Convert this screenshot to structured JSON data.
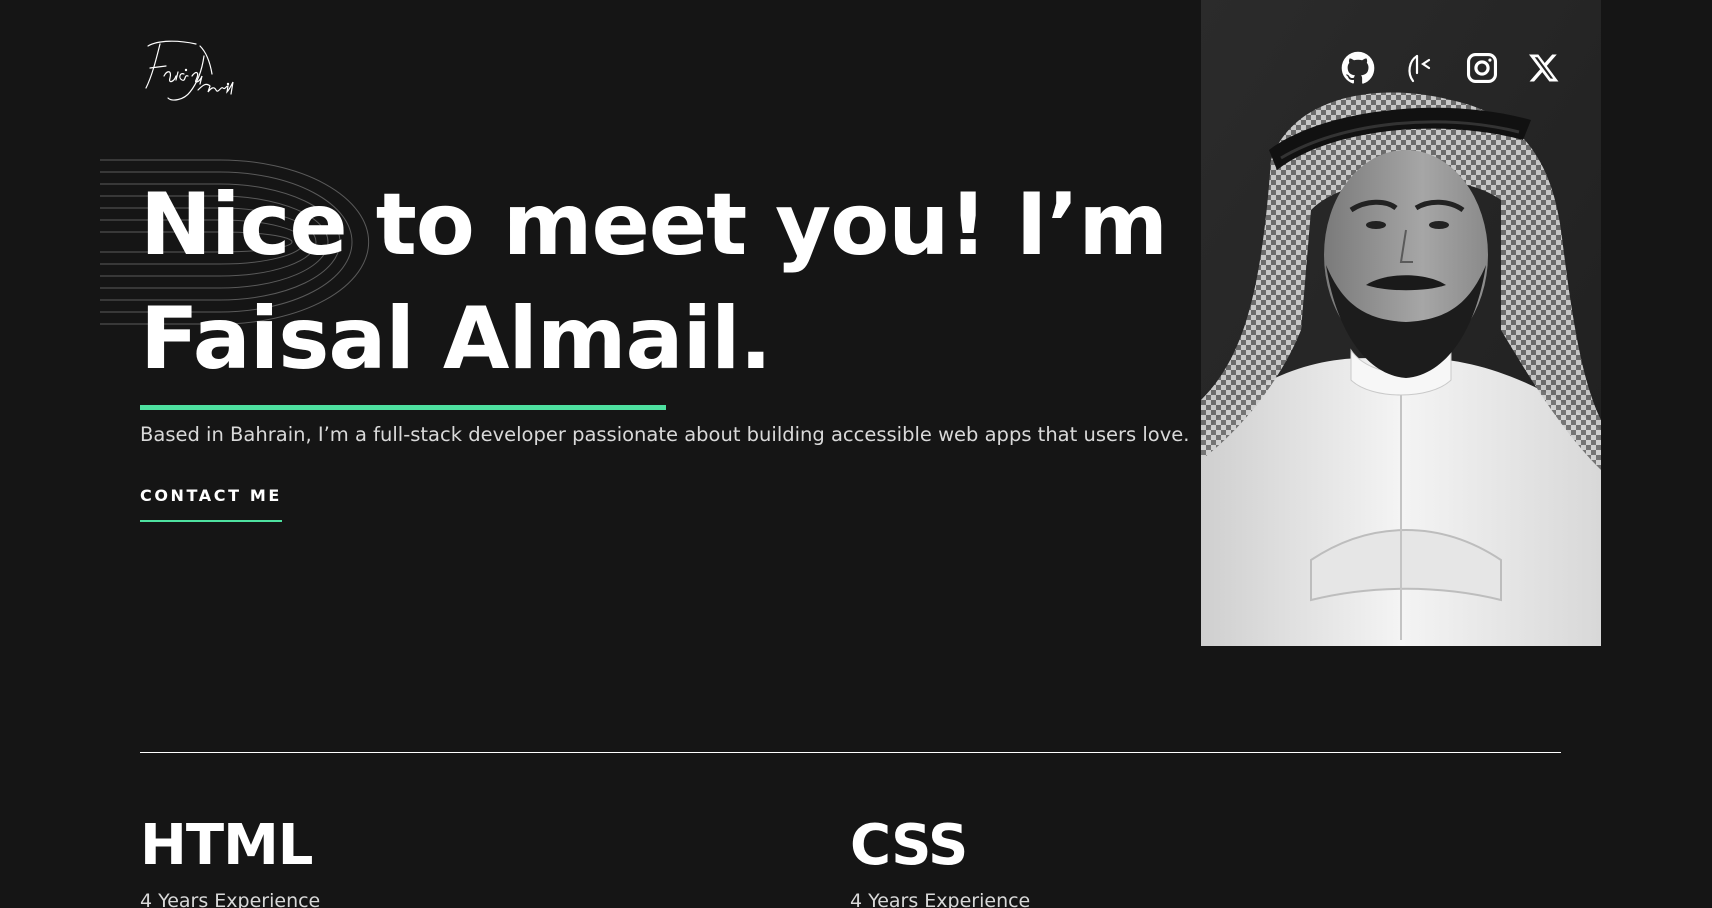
{
  "brand": {
    "logo_text": "Faisal Almail"
  },
  "hero": {
    "headline_line1": "Nice to meet you! I’m",
    "headline_name": "Faisal Almail",
    "headline_period": ".",
    "intro": "Based in Bahrain, I’m a full-stack developer passionate about building accessible web apps that users love.",
    "contact_label": "CONTACT ME"
  },
  "socials": [
    {
      "icon": "github-icon"
    },
    {
      "icon": "mastodon-like-icon"
    },
    {
      "icon": "instagram-icon"
    },
    {
      "icon": "x-icon"
    }
  ],
  "skills": [
    {
      "title": "HTML",
      "experience": "4 Years Experience"
    },
    {
      "title": "CSS",
      "experience": "4 Years Experience"
    }
  ],
  "colors": {
    "background": "#151515",
    "accent": "#4ee1a0",
    "text": "#ffffff",
    "muted_text": "#d9d9d9",
    "portrait_bg": "#262626"
  }
}
